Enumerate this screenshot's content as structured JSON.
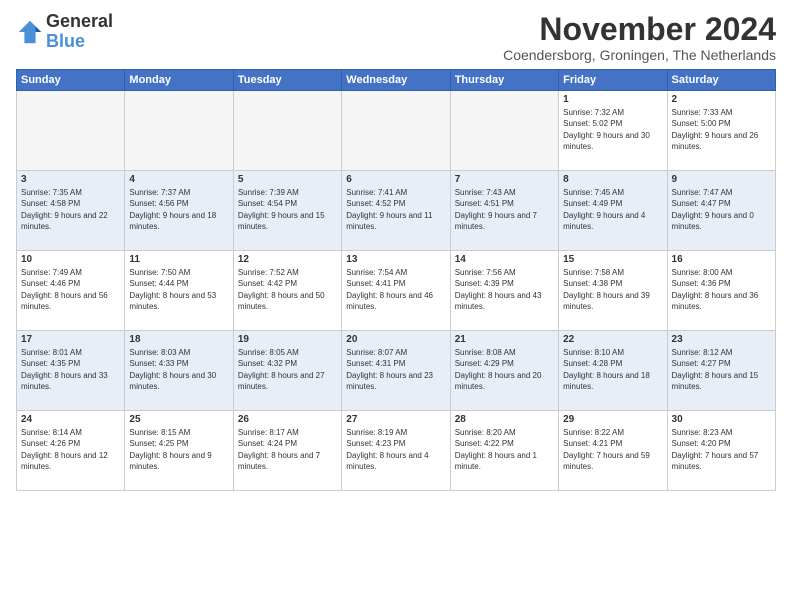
{
  "header": {
    "logo_general": "General",
    "logo_blue": "Blue",
    "month_title": "November 2024",
    "location": "Coendersborg, Groningen, The Netherlands"
  },
  "days_of_week": [
    "Sunday",
    "Monday",
    "Tuesday",
    "Wednesday",
    "Thursday",
    "Friday",
    "Saturday"
  ],
  "weeks": [
    [
      {
        "day": "",
        "info": ""
      },
      {
        "day": "",
        "info": ""
      },
      {
        "day": "",
        "info": ""
      },
      {
        "day": "",
        "info": ""
      },
      {
        "day": "",
        "info": ""
      },
      {
        "day": "1",
        "info": "Sunrise: 7:32 AM\nSunset: 5:02 PM\nDaylight: 9 hours and 30 minutes."
      },
      {
        "day": "2",
        "info": "Sunrise: 7:33 AM\nSunset: 5:00 PM\nDaylight: 9 hours and 26 minutes."
      }
    ],
    [
      {
        "day": "3",
        "info": "Sunrise: 7:35 AM\nSunset: 4:58 PM\nDaylight: 9 hours and 22 minutes."
      },
      {
        "day": "4",
        "info": "Sunrise: 7:37 AM\nSunset: 4:56 PM\nDaylight: 9 hours and 18 minutes."
      },
      {
        "day": "5",
        "info": "Sunrise: 7:39 AM\nSunset: 4:54 PM\nDaylight: 9 hours and 15 minutes."
      },
      {
        "day": "6",
        "info": "Sunrise: 7:41 AM\nSunset: 4:52 PM\nDaylight: 9 hours and 11 minutes."
      },
      {
        "day": "7",
        "info": "Sunrise: 7:43 AM\nSunset: 4:51 PM\nDaylight: 9 hours and 7 minutes."
      },
      {
        "day": "8",
        "info": "Sunrise: 7:45 AM\nSunset: 4:49 PM\nDaylight: 9 hours and 4 minutes."
      },
      {
        "day": "9",
        "info": "Sunrise: 7:47 AM\nSunset: 4:47 PM\nDaylight: 9 hours and 0 minutes."
      }
    ],
    [
      {
        "day": "10",
        "info": "Sunrise: 7:49 AM\nSunset: 4:46 PM\nDaylight: 8 hours and 56 minutes."
      },
      {
        "day": "11",
        "info": "Sunrise: 7:50 AM\nSunset: 4:44 PM\nDaylight: 8 hours and 53 minutes."
      },
      {
        "day": "12",
        "info": "Sunrise: 7:52 AM\nSunset: 4:42 PM\nDaylight: 8 hours and 50 minutes."
      },
      {
        "day": "13",
        "info": "Sunrise: 7:54 AM\nSunset: 4:41 PM\nDaylight: 8 hours and 46 minutes."
      },
      {
        "day": "14",
        "info": "Sunrise: 7:56 AM\nSunset: 4:39 PM\nDaylight: 8 hours and 43 minutes."
      },
      {
        "day": "15",
        "info": "Sunrise: 7:58 AM\nSunset: 4:38 PM\nDaylight: 8 hours and 39 minutes."
      },
      {
        "day": "16",
        "info": "Sunrise: 8:00 AM\nSunset: 4:36 PM\nDaylight: 8 hours and 36 minutes."
      }
    ],
    [
      {
        "day": "17",
        "info": "Sunrise: 8:01 AM\nSunset: 4:35 PM\nDaylight: 8 hours and 33 minutes."
      },
      {
        "day": "18",
        "info": "Sunrise: 8:03 AM\nSunset: 4:33 PM\nDaylight: 8 hours and 30 minutes."
      },
      {
        "day": "19",
        "info": "Sunrise: 8:05 AM\nSunset: 4:32 PM\nDaylight: 8 hours and 27 minutes."
      },
      {
        "day": "20",
        "info": "Sunrise: 8:07 AM\nSunset: 4:31 PM\nDaylight: 8 hours and 23 minutes."
      },
      {
        "day": "21",
        "info": "Sunrise: 8:08 AM\nSunset: 4:29 PM\nDaylight: 8 hours and 20 minutes."
      },
      {
        "day": "22",
        "info": "Sunrise: 8:10 AM\nSunset: 4:28 PM\nDaylight: 8 hours and 18 minutes."
      },
      {
        "day": "23",
        "info": "Sunrise: 8:12 AM\nSunset: 4:27 PM\nDaylight: 8 hours and 15 minutes."
      }
    ],
    [
      {
        "day": "24",
        "info": "Sunrise: 8:14 AM\nSunset: 4:26 PM\nDaylight: 8 hours and 12 minutes."
      },
      {
        "day": "25",
        "info": "Sunrise: 8:15 AM\nSunset: 4:25 PM\nDaylight: 8 hours and 9 minutes."
      },
      {
        "day": "26",
        "info": "Sunrise: 8:17 AM\nSunset: 4:24 PM\nDaylight: 8 hours and 7 minutes."
      },
      {
        "day": "27",
        "info": "Sunrise: 8:19 AM\nSunset: 4:23 PM\nDaylight: 8 hours and 4 minutes."
      },
      {
        "day": "28",
        "info": "Sunrise: 8:20 AM\nSunset: 4:22 PM\nDaylight: 8 hours and 1 minute."
      },
      {
        "day": "29",
        "info": "Sunrise: 8:22 AM\nSunset: 4:21 PM\nDaylight: 7 hours and 59 minutes."
      },
      {
        "day": "30",
        "info": "Sunrise: 8:23 AM\nSunset: 4:20 PM\nDaylight: 7 hours and 57 minutes."
      }
    ]
  ]
}
